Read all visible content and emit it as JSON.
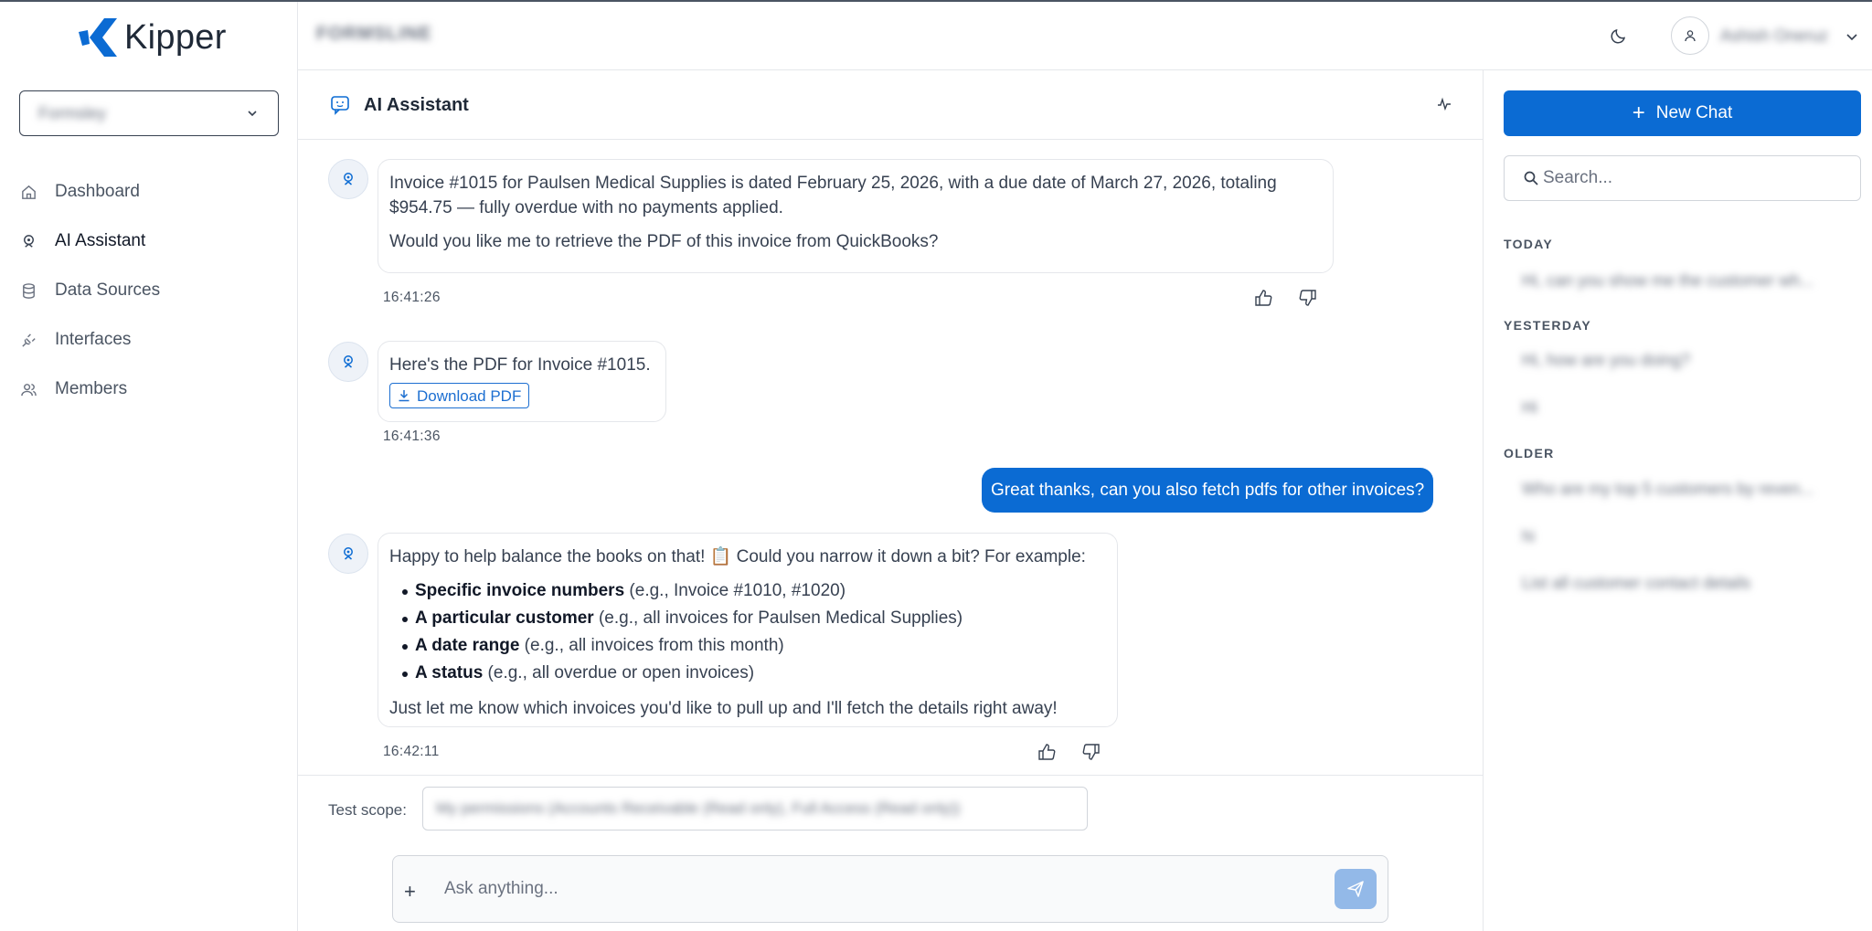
{
  "app": {
    "logo_text": "Kipper"
  },
  "sidebar": {
    "workspace": "Formsley",
    "items": [
      {
        "label": "Dashboard",
        "icon": "home-icon"
      },
      {
        "label": "AI Assistant",
        "icon": "bot-icon"
      },
      {
        "label": "Data Sources",
        "icon": "database-icon"
      },
      {
        "label": "Interfaces",
        "icon": "plug-icon"
      },
      {
        "label": "Members",
        "icon": "users-icon"
      }
    ]
  },
  "header": {
    "breadcrumb": "FORMSLINE",
    "user_name": "Ashish Oneruz"
  },
  "chat": {
    "title": "AI Assistant",
    "messages": [
      {
        "role": "assistant",
        "p1": "Invoice #1015 for Paulsen Medical Supplies is dated February 25, 2026, with a due date of March 27, 2026, totaling $954.75 — fully overdue with no payments applied.",
        "p2": "Would you like me to retrieve the PDF of this invoice from QuickBooks?",
        "time": "16:41:26"
      },
      {
        "role": "assistant",
        "p1": "Here's the PDF for Invoice #1015.",
        "button": "Download PDF",
        "time": "16:41:36"
      },
      {
        "role": "user",
        "text": "Great thanks, can you also fetch pdfs for other invoices?"
      },
      {
        "role": "assistant",
        "intro": "Happy to help balance the books on that! 📋 Could you narrow it down a bit? For example:",
        "bullets": [
          {
            "bold": "Specific invoice numbers",
            "rest": " (e.g., Invoice #1010, #1020)"
          },
          {
            "bold": "A particular customer",
            "rest": " (e.g., all invoices for Paulsen Medical Supplies)"
          },
          {
            "bold": "A date range",
            "rest": " (e.g., all invoices from this month)"
          },
          {
            "bold": "A status",
            "rest": " (e.g., all overdue or open invoices)"
          }
        ],
        "outro": "Just let me know which invoices you'd like to pull up and I'll fetch the details right away!",
        "time": "16:42:11"
      }
    ],
    "scope_label": "Test scope:",
    "scope_value": "My permissions (Accounts Receivable (Read only), Full Access (Read only))",
    "composer_placeholder": "Ask anything...",
    "composer_plus": "+"
  },
  "history": {
    "new_chat": "New Chat",
    "search_placeholder": "Search...",
    "sections": [
      {
        "label": "TODAY",
        "items": [
          "Hi, can you show me the customer wh..."
        ]
      },
      {
        "label": "YESTERDAY",
        "items": [
          "Hi, how are you doing?",
          "Hi"
        ]
      },
      {
        "label": "OLDER",
        "items": [
          "Who are my top 5 customers by reven...",
          "hi",
          "List all customer contact details"
        ]
      }
    ]
  },
  "colors": {
    "primary": "#0b6bd3",
    "send_disabled": "#93b9e8"
  }
}
